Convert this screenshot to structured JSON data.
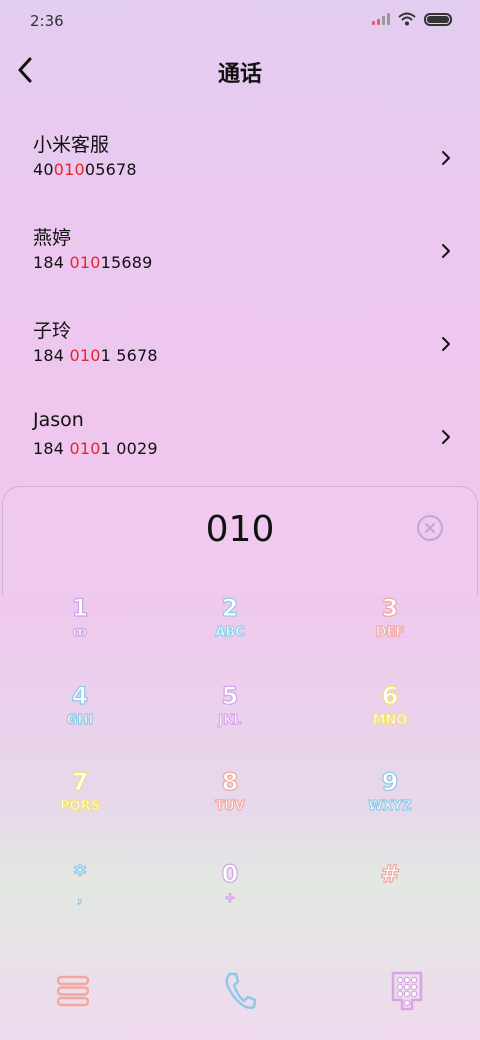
{
  "status_bar": {
    "time": "2:36"
  },
  "header": {
    "title": "通话"
  },
  "contacts": [
    {
      "name": "小米客服",
      "number_parts": [
        "40",
        "010",
        "05678"
      ]
    },
    {
      "name": "燕婷",
      "number_parts": [
        "184 ",
        "010",
        "15689"
      ]
    },
    {
      "name": "子玲",
      "number_parts": [
        "184 ",
        "010",
        "1 5678"
      ]
    },
    {
      "name": "Jason",
      "number_parts": [
        "184 ",
        "010",
        "1 0029"
      ]
    }
  ],
  "dialer": {
    "input": "010"
  },
  "keypad": [
    {
      "digit": "1",
      "letters": "ꝏ",
      "color": "#c9a4e8"
    },
    {
      "digit": "2",
      "letters": "ABC",
      "color": "#8fcfe8"
    },
    {
      "digit": "3",
      "letters": "DEF",
      "color": "#f4a6a0"
    },
    {
      "digit": "4",
      "letters": "GHI",
      "color": "#8fc8e8"
    },
    {
      "digit": "5",
      "letters": "JKL",
      "color": "#d7a4e8"
    },
    {
      "digit": "6",
      "letters": "MNO",
      "color": "#f5e07a"
    },
    {
      "digit": "7",
      "letters": "PQRS",
      "color": "#f5e07a"
    },
    {
      "digit": "8",
      "letters": "TUV",
      "color": "#f4a6a0"
    },
    {
      "digit": "9",
      "letters": "WXYZ",
      "color": "#8fc8e8"
    },
    {
      "digit": "*",
      "letters": ",",
      "color": "#8fc8e8"
    },
    {
      "digit": "0",
      "letters": "+",
      "color": "#d7a4e8"
    },
    {
      "digit": "#",
      "letters": "",
      "color": "#f4a6a0"
    }
  ],
  "bottom_bar": {
    "menu_icon_color": "#f4a6a0",
    "call_icon_color": "#8fc8e8",
    "keypad_icon_color": "#d7a4e8"
  }
}
